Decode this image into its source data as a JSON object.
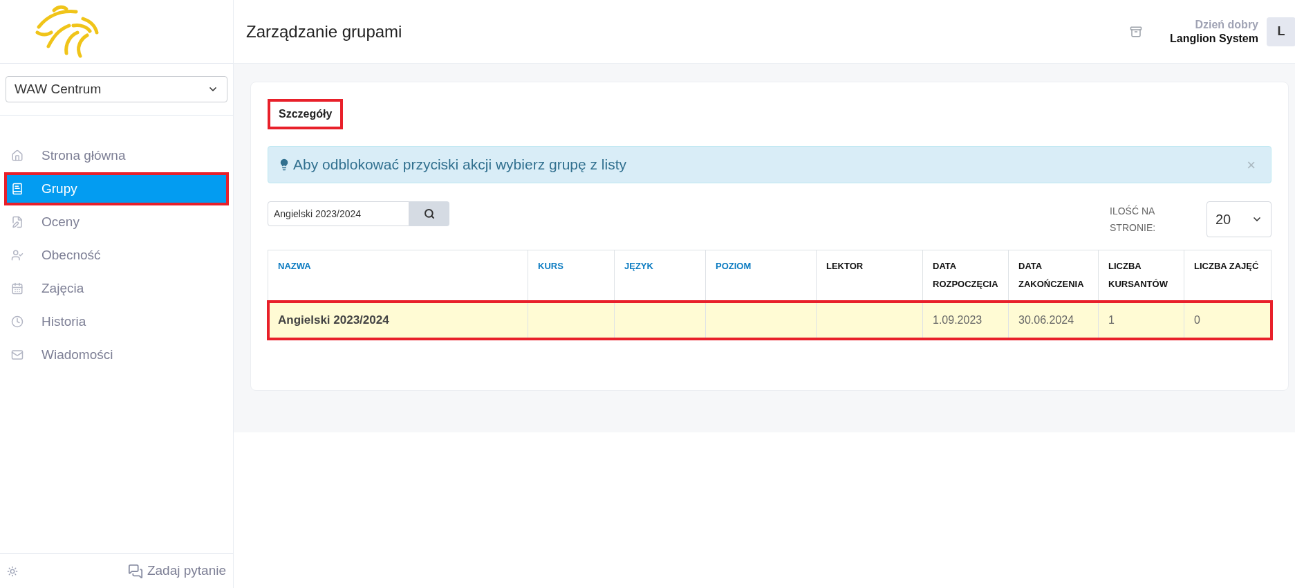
{
  "sidebar": {
    "branch_select": {
      "value": "WAW Centrum"
    },
    "items": [
      {
        "label": "Strona główna",
        "selected": false,
        "highlighted": false
      },
      {
        "label": "Grupy",
        "selected": true,
        "highlighted": true
      },
      {
        "label": "Oceny",
        "selected": false,
        "highlighted": false
      },
      {
        "label": "Obecność",
        "selected": false,
        "highlighted": false
      },
      {
        "label": "Zajęcia",
        "selected": false,
        "highlighted": false
      },
      {
        "label": "Historia",
        "selected": false,
        "highlighted": false
      },
      {
        "label": "Wiadomości",
        "selected": false,
        "highlighted": false
      }
    ],
    "footer": {
      "help_link": "Zadaj pytanie"
    }
  },
  "header": {
    "title": "Zarządzanie grupami",
    "greeting": "Dzień dobry",
    "user_name": "Langlion System",
    "avatar": "L"
  },
  "tabs": [
    {
      "label": "Szczegóły",
      "selected": true,
      "highlighted": true
    }
  ],
  "alert": {
    "text": "Aby odblokować przyciski akcji wybierz grupę z listy",
    "close": "×"
  },
  "search": {
    "value": "Angielski 2023/2024"
  },
  "per_page": {
    "label": "ILOŚĆ NA STRONIE:",
    "value": "20"
  },
  "table": {
    "columns": [
      {
        "label": "NAZWA",
        "sortable": true
      },
      {
        "label": "KURS",
        "sortable": true
      },
      {
        "label": "JĘZYK",
        "sortable": true
      },
      {
        "label": "POZIOM",
        "sortable": true
      },
      {
        "label": "LEKTOR",
        "sortable": false
      },
      {
        "label": "DATA ROZPOCZĘCIA",
        "sortable": false
      },
      {
        "label": "DATA ZAKOŃCZENIA",
        "sortable": false
      },
      {
        "label": "LICZBA KURSANTÓW",
        "sortable": false
      },
      {
        "label": "LICZBA ZAJĘĆ",
        "sortable": false
      }
    ],
    "rows": [
      {
        "selected": true,
        "highlighted": true,
        "cells": [
          "Angielski 2023/2024",
          "",
          "",
          "",
          "",
          "1.09.2023",
          "30.06.2024",
          "1",
          "0"
        ]
      }
    ]
  }
}
